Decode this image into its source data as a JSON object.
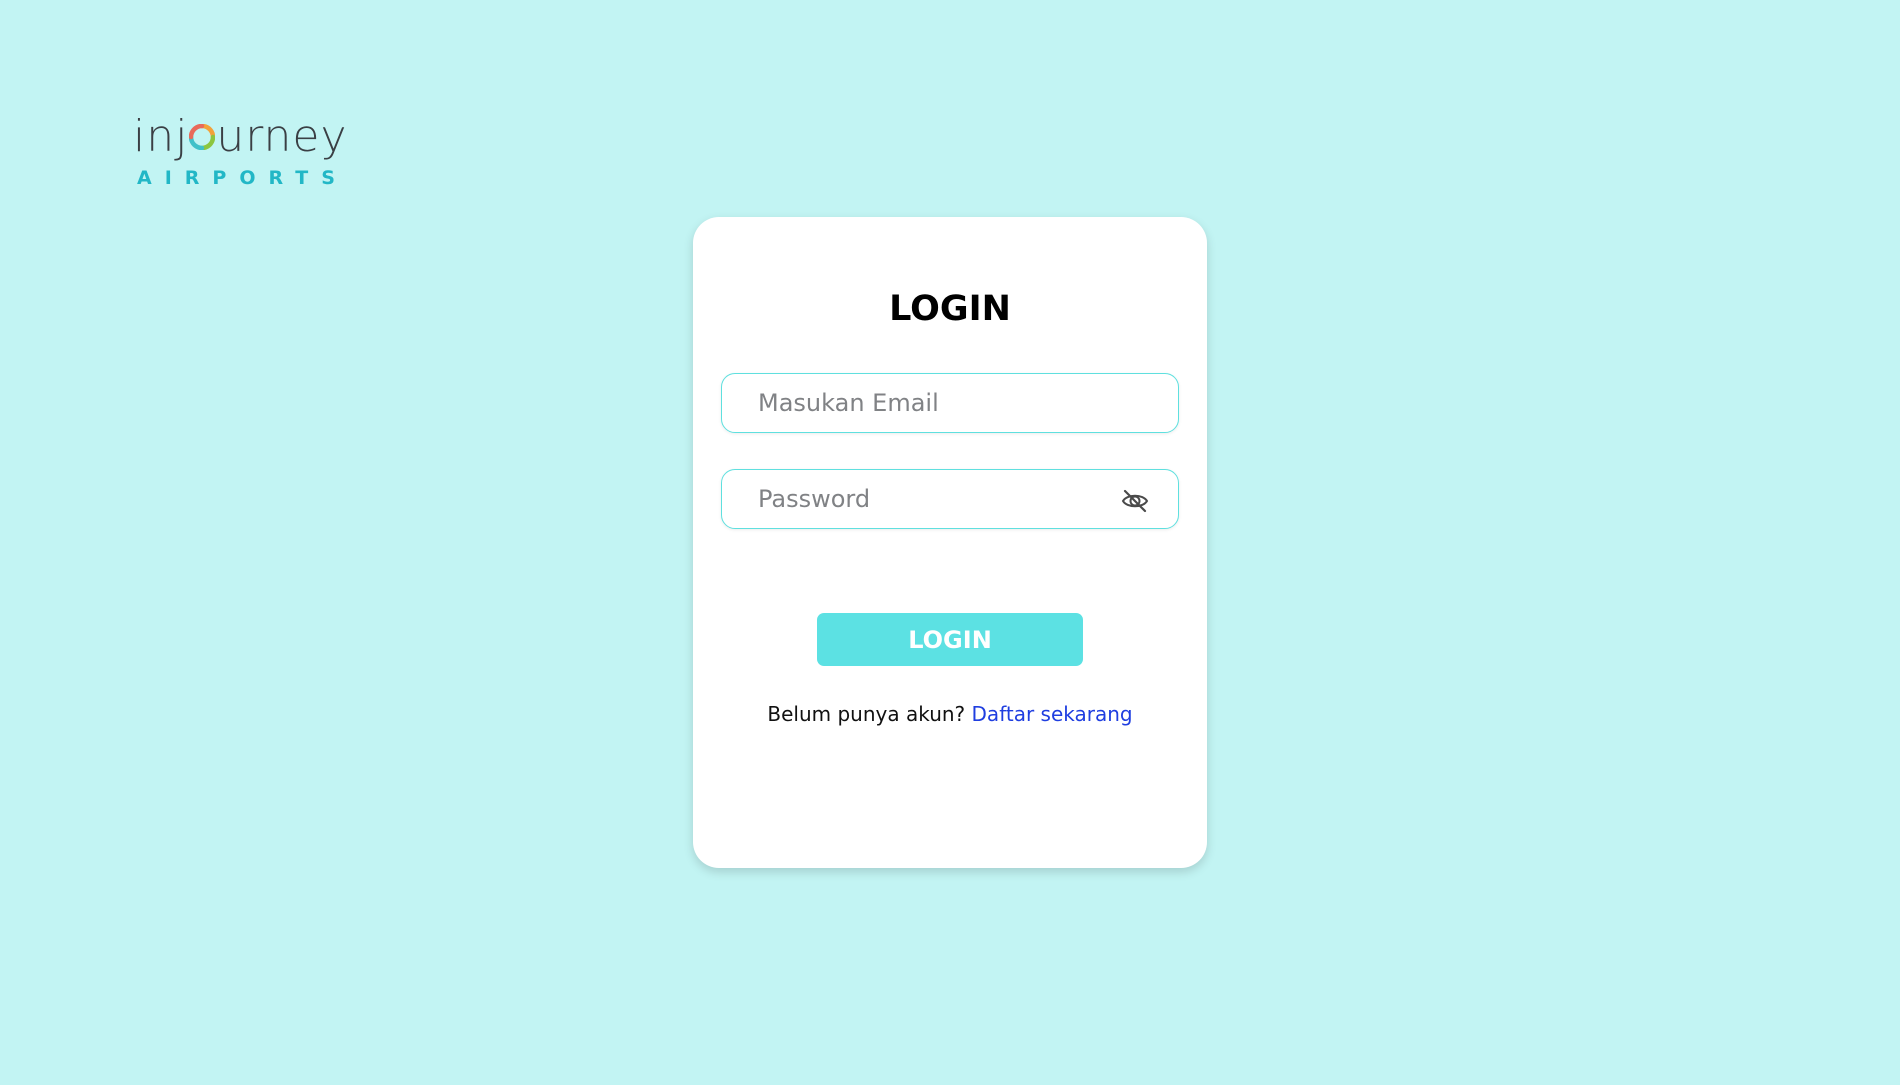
{
  "brand": {
    "wordmark_left": "inj",
    "wordmark_right": "urney",
    "subtitle": "AIRPORTS",
    "ring_colors": [
      "#f2a23a",
      "#8cc63f",
      "#3fc1c9",
      "#e86a5a"
    ],
    "subtitle_color": "#22b7c6"
  },
  "login_card": {
    "title": "LOGIN",
    "email_placeholder": "Masukan Email",
    "email_value": "",
    "password_placeholder": "Password",
    "password_value": "",
    "password_toggle_icon": "eye-off-icon",
    "login_button_label": "LOGIN",
    "signup_prompt": "Belum punya akun?",
    "signup_link": "Daftar sekarang"
  },
  "colors": {
    "background": "#c2f4f3",
    "accent": "#5ce1e3",
    "link": "#1f3ee0"
  }
}
